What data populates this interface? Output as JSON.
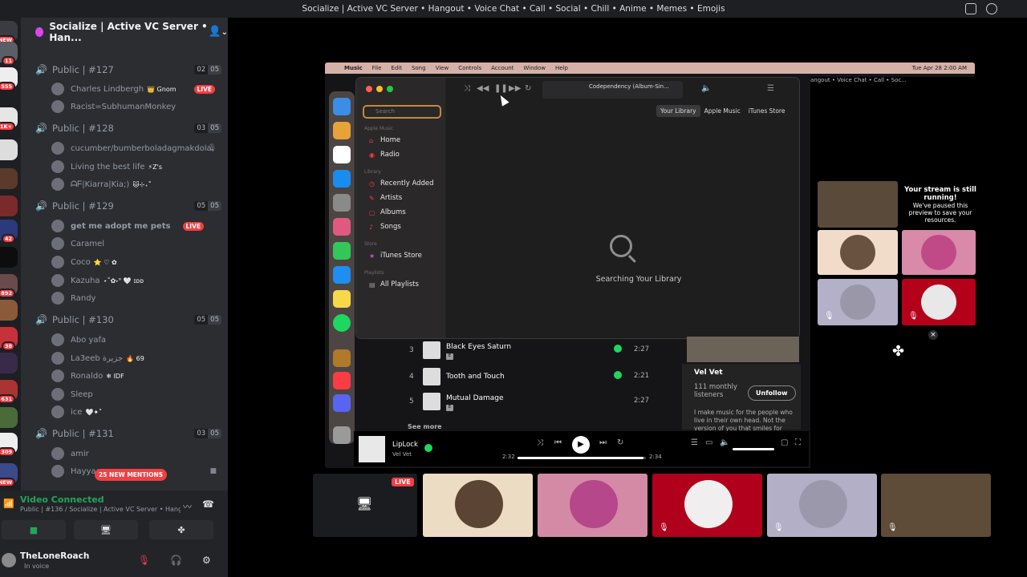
{
  "window": {
    "title": "Socialize | Active VC Server • Hangout • Voice Chat • Call • Social • Chill • Anime • Memes • Emojis"
  },
  "server_rail": {
    "badges": [
      "NEW",
      "11",
      "555",
      "1K+",
      "42",
      "892",
      "38",
      "631",
      "309",
      "NEW"
    ]
  },
  "server": {
    "name": "Socialize | Active VC Server • Han..."
  },
  "channels": [
    {
      "name": "Public | #127",
      "count_a": "02",
      "count_b": "05",
      "users": [
        {
          "name": "Charles Lindbergh",
          "tag": "👑 Gnom",
          "live": "LIVE"
        },
        {
          "name": "Racist=SubhumanMonkey"
        }
      ]
    },
    {
      "name": "Public | #128",
      "count_a": "03",
      "count_b": "05",
      "users": [
        {
          "name": "cucumber/bumberboladagmakdola"
        },
        {
          "name": "Living the best life",
          "tag": "⚡Z's"
        },
        {
          "name": "ᗩᖴ|Kiarra|Kia;)",
          "tag": "🐱⊹₊˚"
        }
      ]
    },
    {
      "name": "Public | #129",
      "count_a": "05",
      "count_b": "05",
      "users": [
        {
          "name": "get me adopt me pets",
          "live": "LIVE"
        },
        {
          "name": "Caramel"
        },
        {
          "name": "Coco",
          "tag": "⭐ ♡ ✿"
        },
        {
          "name": "Kazuha",
          "tag": "⋆˚✿˖° 🤍 ɪᴅᴅ"
        },
        {
          "name": "Randy"
        }
      ]
    },
    {
      "name": "Public | #130",
      "count_a": "05",
      "count_b": "05",
      "users": [
        {
          "name": "Abo yafa"
        },
        {
          "name": "La3eeb جزيرة",
          "tag": "🔥 69"
        },
        {
          "name": "Ronaldo",
          "tag": "❄ IDF"
        },
        {
          "name": "Sleep"
        },
        {
          "name": "ice",
          "tag": "🤍✦˚"
        }
      ]
    },
    {
      "name": "Public | #131",
      "count_a": "03",
      "count_b": "05",
      "users": [
        {
          "name": "amir"
        },
        {
          "name": "Hayyaa"
        }
      ]
    }
  ],
  "mentions_pill": "25 NEW MENTIONS",
  "voice": {
    "status": "Video Connected",
    "location": "Public | #136 / Socialize | Active VC Server • Hango..."
  },
  "user": {
    "name": "TheLoneRoach",
    "status": "In voice"
  },
  "mac_menubar": {
    "items": [
      "Music",
      "File",
      "Edit",
      "Song",
      "View",
      "Controls",
      "Account",
      "Window",
      "Help"
    ],
    "clock": "Tue Apr 28  2:00 AM"
  },
  "music": {
    "now_playing": "Codependency (Album-Sin...",
    "search_placeholder": "Search",
    "section_apple_music": "Apple Music",
    "section_library": "Library",
    "section_store": "Store",
    "section_playlists": "Playlists",
    "items_top": [
      "Home",
      "Radio"
    ],
    "items_library": [
      "Recently Added",
      "Artists",
      "Albums",
      "Songs"
    ],
    "item_store": "iTunes Store",
    "item_playlists": "All Playlists",
    "tabs": [
      "Your Library",
      "Apple Music",
      "iTunes Store"
    ],
    "status": "Searching Your Library"
  },
  "spotify": {
    "tracks": [
      {
        "num": "3",
        "name": "Black Eyes Saturn",
        "dur": "2:27"
      },
      {
        "num": "4",
        "name": "Tooth and Touch",
        "dur": "2:21"
      },
      {
        "num": "5",
        "name": "Mutual Damage",
        "dur": "2:27"
      }
    ],
    "see_more": "See more",
    "artist": {
      "name": "Vel Vet",
      "listeners": "111 monthly listeners",
      "follow_btn": "Unfollow",
      "bio": "I make music for the people who live in their own head. Not the version of you that smiles for"
    },
    "player": {
      "song": "LipLock",
      "artist": "Vel Vet",
      "elapsed": "2:32",
      "total": "2:34",
      "progress": 0.98
    }
  },
  "discord_inner_title": "angout • Voice Chat • Call • Soc...",
  "stream_note": {
    "title": "Your stream is still running!",
    "body": "We've paused this preview to save your resources."
  },
  "stage_live_tag": "LIVE"
}
